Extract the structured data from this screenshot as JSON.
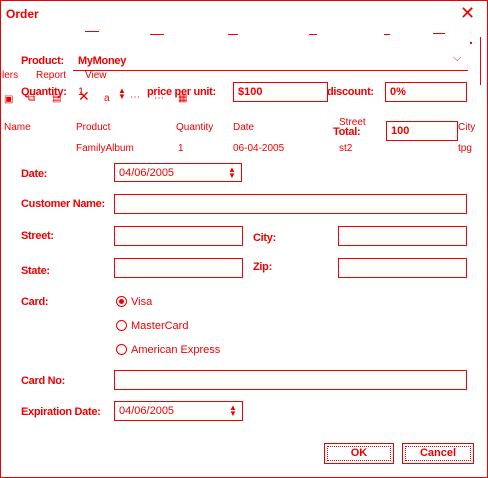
{
  "window": {
    "title": "Order"
  },
  "product": {
    "label": "Product:",
    "value": "MyMoney"
  },
  "quantity": {
    "label": "Quantity:",
    "value": "1"
  },
  "price": {
    "label": "price per unit:",
    "value": "$100"
  },
  "discount": {
    "label": "discount:",
    "value": "0%"
  },
  "total": {
    "label": "Total:",
    "value": "100"
  },
  "background_app": {
    "menu": [
      "lers",
      "Report",
      "View"
    ],
    "columns": [
      "Name",
      "Product",
      "Quantity",
      "Date",
      "Street",
      "City"
    ],
    "row": [
      "",
      "FamilyAlbum",
      "1",
      "06-04-2005",
      "st2",
      "tpg"
    ]
  },
  "date": {
    "label": "Date:",
    "value": "04/06/2005"
  },
  "customer_name": {
    "label": "Customer Name:",
    "value": ""
  },
  "street": {
    "label": "Street:",
    "value": ""
  },
  "city": {
    "label": "City:",
    "value": ""
  },
  "state": {
    "label": "State:",
    "value": ""
  },
  "zip": {
    "label": "Zip:",
    "value": ""
  },
  "card": {
    "label": "Card:",
    "options": [
      "Visa",
      "MasterCard",
      "American Express"
    ],
    "selected": "Visa"
  },
  "card_no": {
    "label": "Card No:",
    "value": ""
  },
  "expiration": {
    "label": "Expiration Date:",
    "value": "04/06/2005"
  },
  "buttons": {
    "ok": "OK",
    "cancel": "Cancel"
  },
  "colors": {
    "accent": "#ee0000",
    "background": "#ffffff"
  },
  "icons": [
    "close-icon",
    "chevron-down-icon",
    "spinner-icon",
    "toolbar-icons"
  ]
}
